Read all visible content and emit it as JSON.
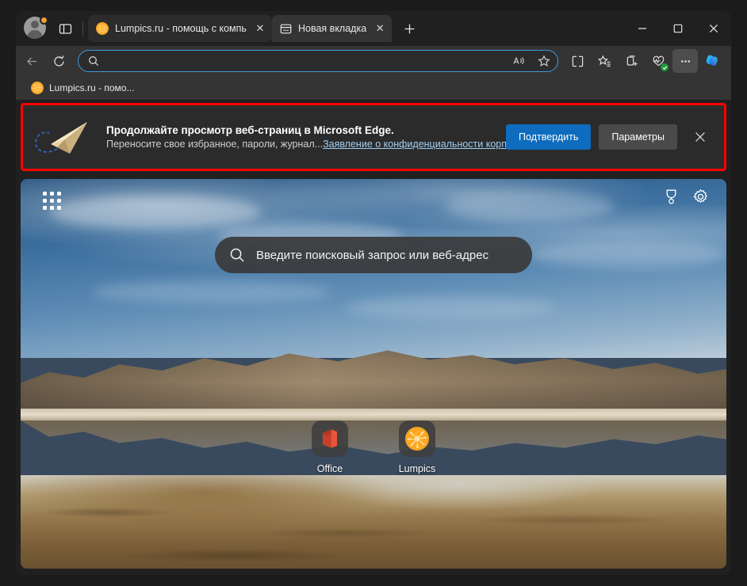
{
  "window": {
    "minimize_label": "—",
    "maximize_label": "□",
    "close_label": "✕"
  },
  "tabstrip": {
    "profile_icon": "avatar-icon",
    "tab_actions_icon": "tab-actions-icon",
    "new_tab_label": "+",
    "tabs": [
      {
        "title": "Lumpics.ru - помощь с компьюте",
        "icon": "citrus-favicon",
        "active": false,
        "close_label": "✕"
      },
      {
        "title": "Новая вкладка",
        "icon": "new-tab-page-icon",
        "active": true,
        "close_label": "✕"
      }
    ]
  },
  "toolbar": {
    "back_icon": "back-arrow-icon",
    "refresh_icon": "refresh-icon",
    "search_icon": "search-icon",
    "address_value": "",
    "address_placeholder": "",
    "read_aloud_icon": "read-aloud-icon",
    "favorite_icon": "star-icon",
    "split_screen_icon": "split-screen-icon",
    "favorites_list_icon": "favorites-list-icon",
    "collections_icon": "collections-icon",
    "browser_essentials_icon": "browser-essentials-icon",
    "more_icon": "more-options-icon",
    "copilot_icon": "copilot-icon"
  },
  "favorites_bar": {
    "items": [
      {
        "label": "Lumpics.ru - помо...",
        "icon": "citrus-favicon"
      }
    ]
  },
  "banner": {
    "illustration": "paper-plane-icon",
    "title": "Продолжайте просмотр веб-страниц в Microsoft Edge.",
    "subtitle": "Переносите свое избранное, пароли, журнал...",
    "link_text": "Заявление о конфиденциальности корпора...",
    "confirm_label": "Подтвердить",
    "settings_label": "Параметры",
    "close_label": "✕",
    "accent_color": "#0d6cbd",
    "highlight_color": "#ff0000",
    "link_color": "#9fd0f5"
  },
  "new_tab_page": {
    "app_launcher_icon": "app-launcher-icon",
    "rewards_icon": "rewards-medal-icon",
    "settings_icon": "gear-icon",
    "search_icon": "search-icon",
    "search_placeholder": "Введите поисковый запрос или веб-адрес",
    "tiles": [
      {
        "label": "Office",
        "icon": "office-icon"
      },
      {
        "label": "Lumpics",
        "icon": "citrus-icon"
      }
    ]
  }
}
